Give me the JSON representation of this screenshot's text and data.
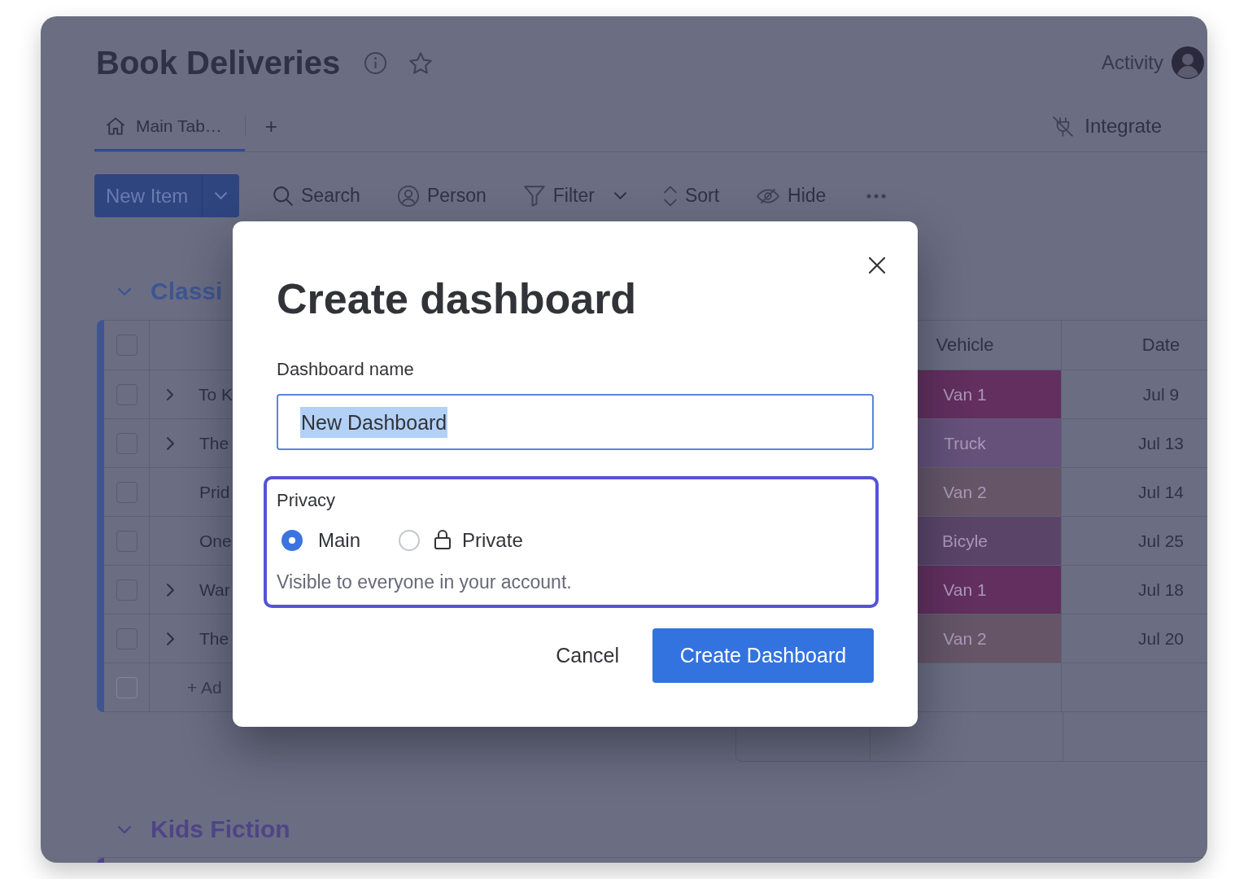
{
  "board": {
    "title": "Book Deliveries",
    "starred": false,
    "activity_label": "Activity",
    "tabs": [
      {
        "kind": "home",
        "label": "Main Tab…",
        "selected": true
      }
    ],
    "add_tab_label": "+",
    "integrate_label": "Integrate"
  },
  "toolbar": {
    "new_item_label": "New Item",
    "items": [
      {
        "kind": "search",
        "label": "Search",
        "dropdown": false
      },
      {
        "kind": "person",
        "label": "Person",
        "dropdown": false
      },
      {
        "kind": "filter",
        "label": "Filter",
        "dropdown": true
      },
      {
        "kind": "sort",
        "label": "Sort",
        "dropdown": false
      },
      {
        "kind": "hide",
        "label": "Hide",
        "dropdown": false
      }
    ]
  },
  "groups": [
    {
      "title": "Classi",
      "color": "#3e5591",
      "expanded": true,
      "header_checked": false,
      "columns": [
        "Vehicle",
        "Date"
      ],
      "rows": [
        {
          "name": "To K",
          "expandable": true,
          "checked": false,
          "vehicle": {
            "label": "Van 1",
            "color": "#622f5e"
          },
          "date": "Jul 9"
        },
        {
          "name": "The",
          "expandable": true,
          "checked": false,
          "vehicle": {
            "label": "Truck",
            "color": "#65517a"
          },
          "date": "Jul 13"
        },
        {
          "name": "Prid",
          "expandable": false,
          "checked": false,
          "vehicle": {
            "label": "Van 2",
            "color": "#655567"
          },
          "date": "Jul 14"
        },
        {
          "name": "One",
          "expandable": false,
          "checked": false,
          "vehicle": {
            "label": "Bicyle",
            "color": "#5a4569"
          },
          "date": "Jul 25"
        },
        {
          "name": "War",
          "expandable": true,
          "checked": false,
          "vehicle": {
            "label": "Van 1",
            "color": "#622f5e"
          },
          "date": "Jul 18"
        },
        {
          "name": "The",
          "expandable": true,
          "checked": false,
          "vehicle": {
            "label": "Van 2",
            "color": "#655567"
          },
          "date": "Jul 20"
        }
      ],
      "add_row": {
        "label": "+ Ad",
        "checkbox_disabled": true
      }
    },
    {
      "title": "Kids Fiction",
      "color": "#4f4487",
      "expanded": true
    }
  ],
  "dialog": {
    "title": "Create dashboard",
    "name_field": {
      "label": "Dashboard name",
      "value": "New Dashboard",
      "text_selected": true,
      "focused": true
    },
    "privacy": {
      "label": "Privacy",
      "focused": true,
      "options": [
        {
          "label": "Main",
          "selected": true,
          "locked": false
        },
        {
          "label": "Private",
          "selected": false,
          "locked": true
        }
      ],
      "hint": "Visible to everyone in your account."
    },
    "buttons": [
      {
        "kind": "secondary",
        "label": "Cancel"
      },
      {
        "kind": "primary",
        "label": "Create Dashboard"
      }
    ]
  }
}
